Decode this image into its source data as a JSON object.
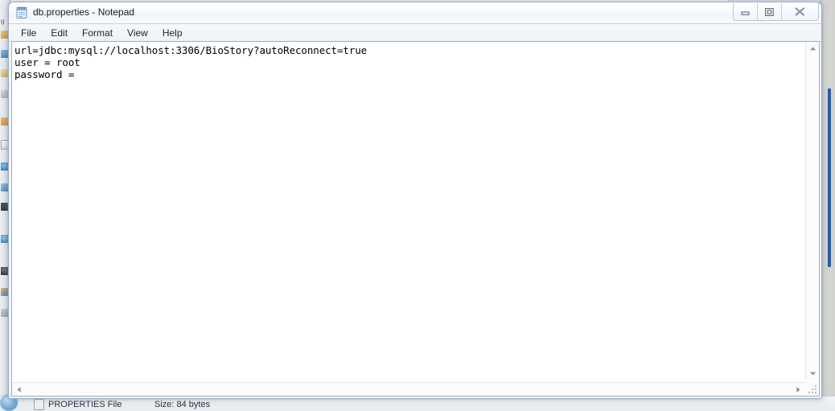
{
  "window": {
    "title": "db.properties - Notepad",
    "icon": "notepad-icon",
    "controls": {
      "minimize": "Minimize",
      "restore": "Restore Down",
      "close": "Close"
    }
  },
  "menubar": {
    "items": [
      {
        "label": "File"
      },
      {
        "label": "Edit"
      },
      {
        "label": "Format"
      },
      {
        "label": "View"
      },
      {
        "label": "Help"
      }
    ]
  },
  "document": {
    "lines": [
      "url=jdbc:mysql://localhost:3306/BioStory?autoReconnect=true",
      "user = root",
      "password = "
    ]
  },
  "scrollbars": {
    "vertical": {
      "up_arrow": "▲",
      "down_arrow": "▼"
    },
    "horizontal": {
      "left_arrow": "◀",
      "right_arrow": "▶"
    }
  },
  "background": {
    "explorer_status": {
      "file_type": "PROPERTIES File",
      "size": "Size: 84 bytes"
    },
    "dock_label": "g"
  },
  "colors": {
    "title_text": "#16191c",
    "document_text": "#000000",
    "window_border": "#9badc4",
    "menu_text": "#1c2227",
    "bg_scroll_thumb": "#2f5aa8"
  }
}
